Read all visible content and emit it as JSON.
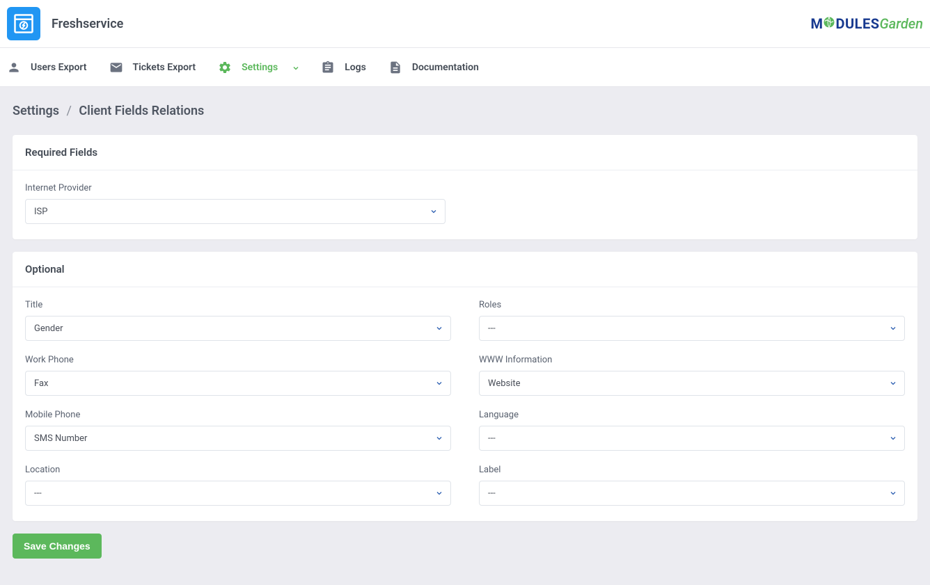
{
  "header": {
    "app_title": "Freshservice",
    "logo": {
      "m": "M",
      "o": "O",
      "dules": "DULES",
      "garden": "Garden"
    }
  },
  "nav": {
    "users_export": "Users Export",
    "tickets_export": "Tickets Export",
    "settings": "Settings",
    "logs": "Logs",
    "documentation": "Documentation"
  },
  "breadcrumb": {
    "root": "Settings",
    "sep": "/",
    "current": "Client Fields Relations"
  },
  "required_fields": {
    "title": "Required Fields",
    "internet_provider": {
      "label": "Internet Provider",
      "value": "ISP"
    }
  },
  "optional": {
    "title": "Optional",
    "left": {
      "title": {
        "label": "Title",
        "value": "Gender"
      },
      "work_phone": {
        "label": "Work Phone",
        "value": "Fax"
      },
      "mobile_phone": {
        "label": "Mobile Phone",
        "value": "SMS Number"
      },
      "location": {
        "label": "Location",
        "value": "---"
      }
    },
    "right": {
      "roles": {
        "label": "Roles",
        "value": "---"
      },
      "www_info": {
        "label": "WWW Information",
        "value": "Website"
      },
      "language": {
        "label": "Language",
        "value": "---"
      },
      "label_field": {
        "label": "Label",
        "value": "---"
      }
    }
  },
  "buttons": {
    "save": "Save Changes"
  },
  "colors": {
    "accent_green": "#5cb85c",
    "accent_blue": "#2196f3",
    "text_dark": "#444b55",
    "bg_page": "#ececf1"
  }
}
